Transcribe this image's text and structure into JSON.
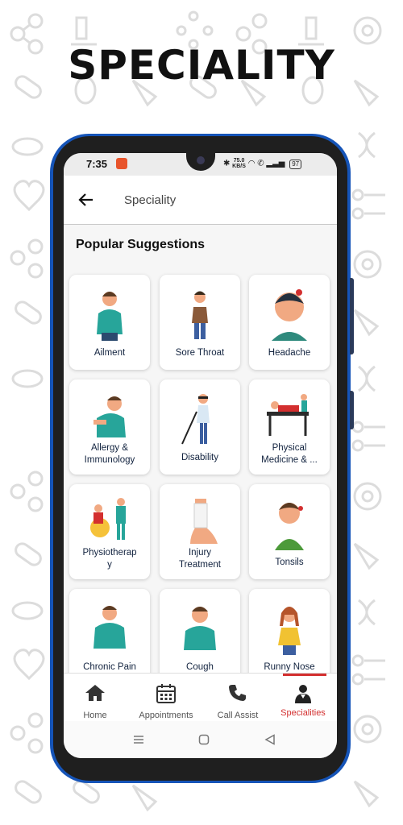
{
  "header": {
    "title": "SPECIALITY"
  },
  "status_bar": {
    "time": "7:35",
    "net_speed_value": "75.0",
    "net_speed_unit": "KB/S",
    "battery": "97"
  },
  "app_bar": {
    "title": "Speciality"
  },
  "section": {
    "title": "Popular Suggestions"
  },
  "specialities": [
    {
      "label": "Ailment"
    },
    {
      "label": "Sore Throat"
    },
    {
      "label": "Headache"
    },
    {
      "label": "Allergy &",
      "label2": "Immunology"
    },
    {
      "label": "Disability"
    },
    {
      "label": "Physical",
      "label2": "Medicine & ..."
    },
    {
      "label": "Physiotherap",
      "label2": "y"
    },
    {
      "label": "Injury",
      "label2": "Treatment"
    },
    {
      "label": "Tonsils"
    },
    {
      "label": "Chronic Pain"
    },
    {
      "label": "Cough"
    },
    {
      "label": "Runny Nose"
    }
  ],
  "bottom_nav": {
    "items": [
      {
        "label": "Home",
        "icon": "home-icon"
      },
      {
        "label": "Appointments",
        "icon": "calendar-icon"
      },
      {
        "label": "Call Assist",
        "icon": "phone-icon"
      },
      {
        "label": "Specialities",
        "icon": "doctor-icon",
        "active": true
      }
    ]
  },
  "colors": {
    "accent": "#d32f2f",
    "phone_frame": "#1554b8",
    "text_dark": "#12233f",
    "skin": "#f1a982",
    "teal_shirt": "#27a59a"
  }
}
